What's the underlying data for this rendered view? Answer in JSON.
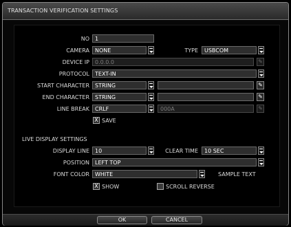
{
  "title": "TRANSACTION VERIFICATION SETTINGS",
  "form": {
    "no_label": "NO",
    "no_value": "1",
    "camera_label": "CAMERA",
    "camera_value": "NONE",
    "type_label": "TYPE",
    "type_value": "USBCOM",
    "device_ip_label": "DEVICE IP",
    "device_ip_value": "0.0.0.0",
    "protocol_label": "PROTOCOL",
    "protocol_value": "TEXT-IN",
    "start_char_label": "START CHARACTER",
    "start_char_value": "STRING",
    "start_char_text": "",
    "end_char_label": "END CHARACTER",
    "end_char_value": "STRING",
    "end_char_text": "",
    "line_break_label": "LINE BREAK",
    "line_break_value": "CRLF",
    "line_break_text": "000A",
    "save_label": "SAVE",
    "save_checked": true
  },
  "live_display": {
    "section_label": "LIVE DISPLAY SETTINGS",
    "display_line_label": "DISPLAY LINE",
    "display_line_value": "10",
    "clear_time_label": "CLEAR TIME",
    "clear_time_value": "10 SEC",
    "position_label": "POSITION",
    "position_value": "LEFT TOP",
    "font_color_label": "FONT COLOR",
    "font_color_value": "WHITE",
    "sample_text": "SAMPLE TEXT",
    "show_label": "SHOW",
    "show_checked": true,
    "scroll_reverse_label": "SCROLL REVERSE",
    "scroll_reverse_checked": false
  },
  "buttons": {
    "ok": "OK",
    "cancel": "CANCEL"
  },
  "icons": {
    "dropdown": "dropdown-arrow-icon",
    "keyboard": "virtual-keyboard-icon",
    "check": "X"
  }
}
